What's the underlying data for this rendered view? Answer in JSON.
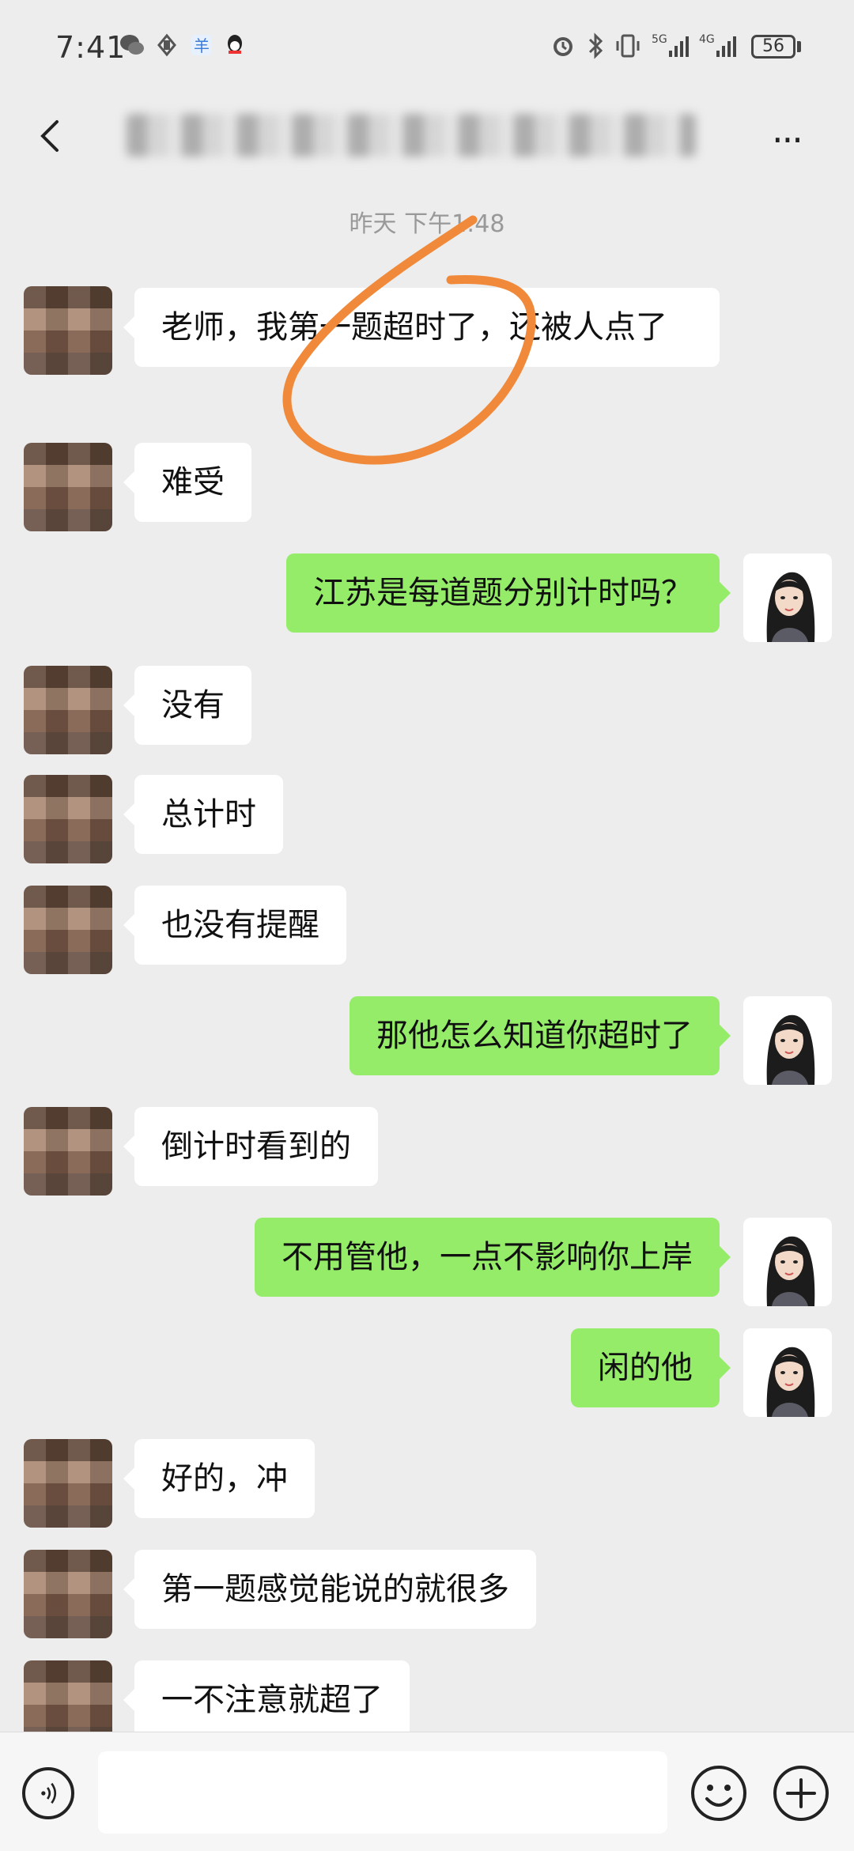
{
  "status_bar": {
    "time": "7:41",
    "battery": "56",
    "network_1": "5G",
    "network_2": "4G"
  },
  "header": {
    "title": "",
    "back_icon": "chevron-left-icon",
    "more_icon": "more-dots-icon"
  },
  "chat": {
    "timestamp": "昨天 下午1:48",
    "messages": [
      {
        "side": "in",
        "text": "老师，我第一题超时了，还被人点了"
      },
      {
        "side": "in",
        "text": "难受"
      },
      {
        "side": "out",
        "text": "江苏是每道题分别计时吗？"
      },
      {
        "side": "in",
        "text": "没有"
      },
      {
        "side": "in",
        "text": "总计时"
      },
      {
        "side": "in",
        "text": "也没有提醒"
      },
      {
        "side": "out",
        "text": "那他怎么知道你超时了"
      },
      {
        "side": "in",
        "text": "倒计时看到的"
      },
      {
        "side": "out",
        "text": "不用管他，一点不影响你上岸"
      },
      {
        "side": "out",
        "text": "闲的他"
      },
      {
        "side": "in",
        "text": "好的，冲"
      },
      {
        "side": "in",
        "text": "第一题感觉能说的就很多"
      },
      {
        "side": "in",
        "text": "一不注意就超了"
      }
    ]
  },
  "colors": {
    "background": "#ededed",
    "out_bubble": "#95ec69",
    "in_bubble": "#ffffff",
    "annotation": "#f08a3a"
  },
  "input_bar": {
    "voice_icon": "voice-icon",
    "emoji_icon": "emoji-icon",
    "plus_icon": "plus-icon"
  }
}
